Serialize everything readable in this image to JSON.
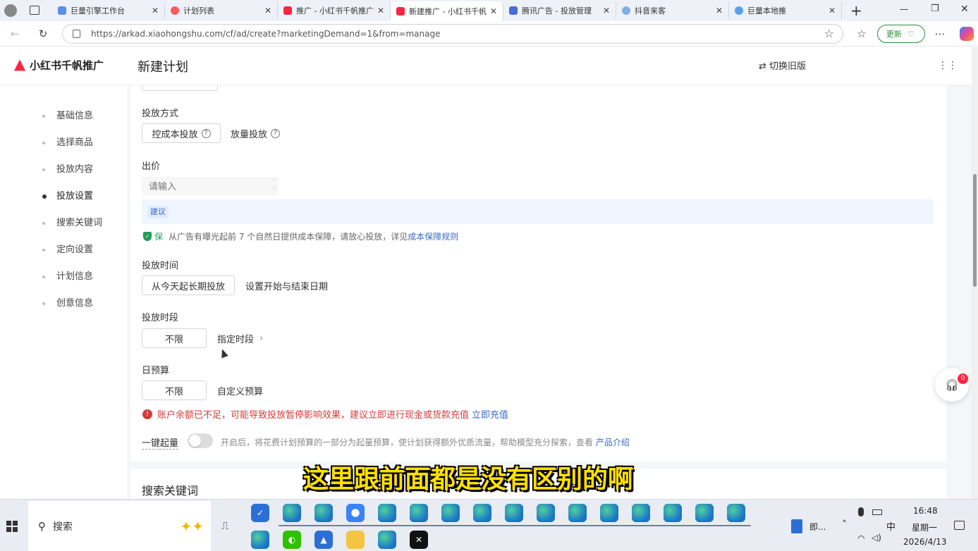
{
  "browser": {
    "tabs": [
      {
        "label": "巨量引擎工作台",
        "color": "#5b8def"
      },
      {
        "label": "计划列表",
        "color": "#ff5a5a"
      },
      {
        "label": "推广 - 小红书千帆推广",
        "color": "#ff2442"
      },
      {
        "label": "新建推广 - 小红书千帆",
        "color": "#ff2442"
      },
      {
        "label": "腾讯广告 - 投放管理",
        "color": "#4b6bd6"
      },
      {
        "label": "抖音来客",
        "color": "#7fb0e8"
      },
      {
        "label": "巨量本地推",
        "color": "#5aa0e8"
      }
    ],
    "close_glyph": "✕",
    "new_tab": "+",
    "url": "https://arkad.xiaohongshu.com/cf/ad/create?marketingDemand=1&from=manage",
    "update_label": "更新",
    "window_controls": {
      "minimize": "—",
      "maximize": "❐",
      "close": "✕"
    }
  },
  "app": {
    "brand": "小红书千帆推广",
    "page_title": "新建计划",
    "switch_label": "切换旧版",
    "switch_icon": "⇄",
    "grid_icon": "⋮⋮"
  },
  "sidebar": {
    "items": [
      {
        "label": "基础信息"
      },
      {
        "label": "选择商品"
      },
      {
        "label": "投放内容"
      },
      {
        "label": "投放设置"
      },
      {
        "label": "搜索关键词"
      },
      {
        "label": "定向设置"
      },
      {
        "label": "计划信息"
      },
      {
        "label": "创意信息"
      }
    ]
  },
  "form": {
    "method": {
      "title": "投放方式",
      "opt1": "控成本投放",
      "opt2": "放量投放",
      "help": "?"
    },
    "bid": {
      "title": "出价",
      "placeholder": "请输入",
      "suggest_tag": "建议"
    },
    "guarantee": {
      "badge": "保",
      "text": "从广告有曝光起前 7 个自然日提供成本保障，请放心投放，详见",
      "link": "成本保障规则"
    },
    "time": {
      "title": "投放时间",
      "opt1": "从今天起长期投放",
      "opt2": "设置开始与结束日期"
    },
    "period": {
      "title": "投放时段",
      "opt1": "不限",
      "opt2": "指定时段",
      "chevron": "›"
    },
    "budget": {
      "title": "日预算",
      "opt1": "不限",
      "opt2": "自定义预算"
    },
    "warning": {
      "icon": "!",
      "text": "账户余额已不足，可能导致投放暂停影响效果，建议立即进行现金或货款充值",
      "link": "立即充值"
    },
    "boost": {
      "label": "一键起量",
      "note": "开启后，将花费计划预算的一部分为起量预算，使计划获得额外优质流量，帮助模型充分探索，查看",
      "link": "产品介绍"
    },
    "next_section": "搜索关键词"
  },
  "subtitle": "这里跟前面都是没有区别的啊",
  "service": {
    "badge": "0"
  },
  "taskbar": {
    "search_label": "搜索",
    "tray_app": "即...",
    "ime": "中",
    "time": "16:48",
    "weekday": "星期一",
    "date": "2026/4/13"
  }
}
